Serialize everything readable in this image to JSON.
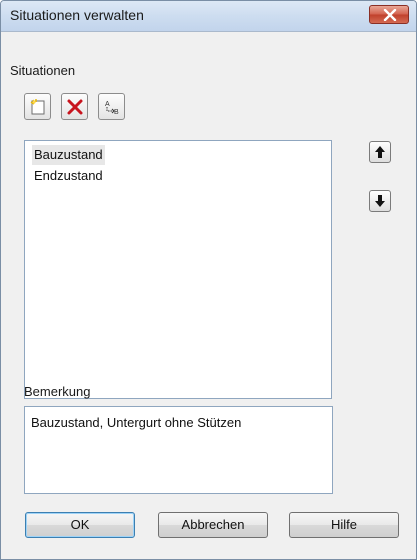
{
  "window": {
    "title": "Situationen verwalten"
  },
  "situations": {
    "label": "Situationen",
    "toolbar": {
      "new_icon": "new-document-icon",
      "delete_icon": "delete-x-icon",
      "rename_icon": "rename-a-to-b-icon"
    },
    "items": [
      {
        "label": "Bauzustand",
        "selected": true
      },
      {
        "label": "Endzustand",
        "selected": false
      }
    ],
    "move_up_icon": "arrow-up-icon",
    "move_down_icon": "arrow-down-icon"
  },
  "remark": {
    "label": "Bemerkung",
    "value": "Bauzustand, Untergurt ohne Stützen"
  },
  "buttons": {
    "ok": "OK",
    "cancel": "Abbrechen",
    "help": "Hilfe"
  },
  "colors": {
    "close_button": "#c0402c",
    "delete_icon": "#c8141e"
  }
}
